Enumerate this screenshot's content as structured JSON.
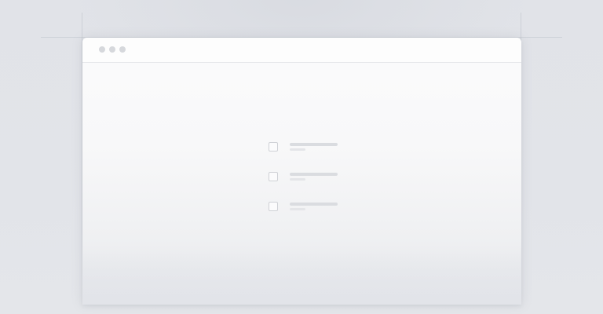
{
  "window": {
    "controls": [
      "window-dot",
      "window-dot",
      "window-dot"
    ]
  },
  "checklist": {
    "items": [
      {
        "checked": false
      },
      {
        "checked": false
      },
      {
        "checked": false
      }
    ]
  },
  "colors": {
    "background": "#e2e4e9",
    "window": "#f8f8f9",
    "titlebar_dot": "#d6d8dc",
    "placeholder_line": "#dadce0",
    "checkbox_border": "#cfd1d6"
  }
}
